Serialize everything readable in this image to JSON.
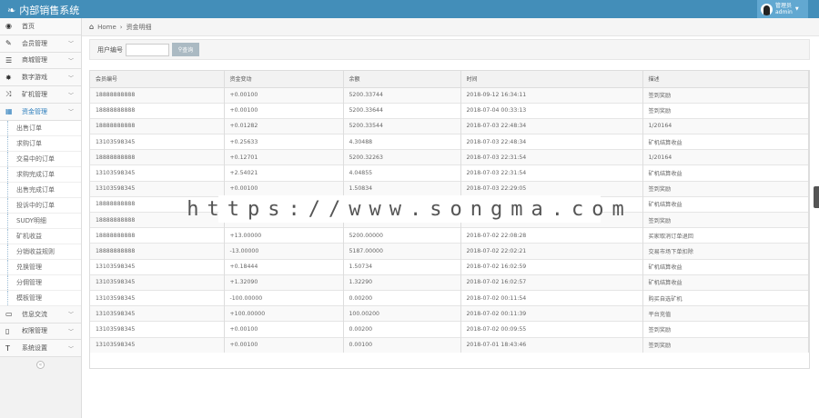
{
  "app": {
    "title": "内部销售系统",
    "user_label": "管理员",
    "user_name": "admin"
  },
  "breadcrumb": {
    "home": "Home",
    "current": "资金明细"
  },
  "sidebar": {
    "items": [
      {
        "label": "首页",
        "icon": "dashboard"
      },
      {
        "label": "会员管理",
        "icon": "edit"
      },
      {
        "label": "商城管理",
        "icon": "list"
      },
      {
        "label": "数字游戏",
        "icon": "star"
      },
      {
        "label": "矿机管理",
        "icon": "shuffle"
      },
      {
        "label": "资金管理",
        "icon": "calendar"
      }
    ],
    "subitems": [
      "出售订单",
      "求购订单",
      "交易中的订单",
      "求购完成订单",
      "出售完成订单",
      "投诉中的订单",
      "SUDY明细",
      "矿机收益",
      "分销收益规则",
      "兑换管理",
      "分佣管理",
      "模板管理"
    ],
    "bottom_items": [
      {
        "label": "信息交流",
        "icon": "desktop"
      },
      {
        "label": "权限管理",
        "icon": "file"
      },
      {
        "label": "系统设置",
        "icon": "text"
      }
    ]
  },
  "search": {
    "label": "用户编号",
    "placeholder": "",
    "button": "查询"
  },
  "table": {
    "headers": [
      "会员编号",
      "资金变动",
      "余额",
      "时间",
      "描述"
    ],
    "rows": [
      [
        "18888888888",
        "+0.00100",
        "5200.33744",
        "2018-09-12 16:34:11",
        "签到奖励"
      ],
      [
        "18888888888",
        "+0.00100",
        "5200.33644",
        "2018-07-04 00:33:13",
        "签到奖励"
      ],
      [
        "18888888888",
        "+0.01282",
        "5200.33544",
        "2018-07-03 22:48:34",
        "1/20164"
      ],
      [
        "13103598345",
        "+0.25633",
        "4.30488",
        "2018-07-03 22:48:34",
        "矿机结算收益"
      ],
      [
        "18888888888",
        "+0.12701",
        "5200.32263",
        "2018-07-03 22:31:54",
        "1/20164"
      ],
      [
        "13103598345",
        "+2.54021",
        "4.04855",
        "2018-07-03 22:31:54",
        "矿机结算收益"
      ],
      [
        "13103598345",
        "+0.00100",
        "1.50834",
        "2018-07-03 22:29:05",
        "签到奖励"
      ],
      [
        "18888888888",
        "",
        "",
        "",
        "矿机结算收益"
      ],
      [
        "18888888888",
        "",
        "",
        "",
        "签到奖励"
      ],
      [
        "18888888888",
        "+13.00000",
        "5200.00000",
        "2018-07-02 22:08:28",
        "买家取消订单退回"
      ],
      [
        "18888888888",
        "-13.00000",
        "5187.00000",
        "2018-07-02 22:02:21",
        "交易市场下单扣除"
      ],
      [
        "13103598345",
        "+0.18444",
        "1.50734",
        "2018-07-02 16:02:59",
        "矿机结算收益"
      ],
      [
        "13103598345",
        "+1.32090",
        "1.32290",
        "2018-07-02 16:02:57",
        "矿机结算收益"
      ],
      [
        "13103598345",
        "-100.00000",
        "0.00200",
        "2018-07-02 00:11:54",
        "购买自选矿机"
      ],
      [
        "13103598345",
        "+100.00000",
        "100.00200",
        "2018-07-02 00:11:39",
        "平台充值"
      ],
      [
        "13103598345",
        "+0.00100",
        "0.00200",
        "2018-07-02 00:09:55",
        "签到奖励"
      ],
      [
        "13103598345",
        "+0.00100",
        "0.00100",
        "2018-07-01 18:43:46",
        "签到奖励"
      ]
    ]
  },
  "watermark": "https://www.songma.com"
}
